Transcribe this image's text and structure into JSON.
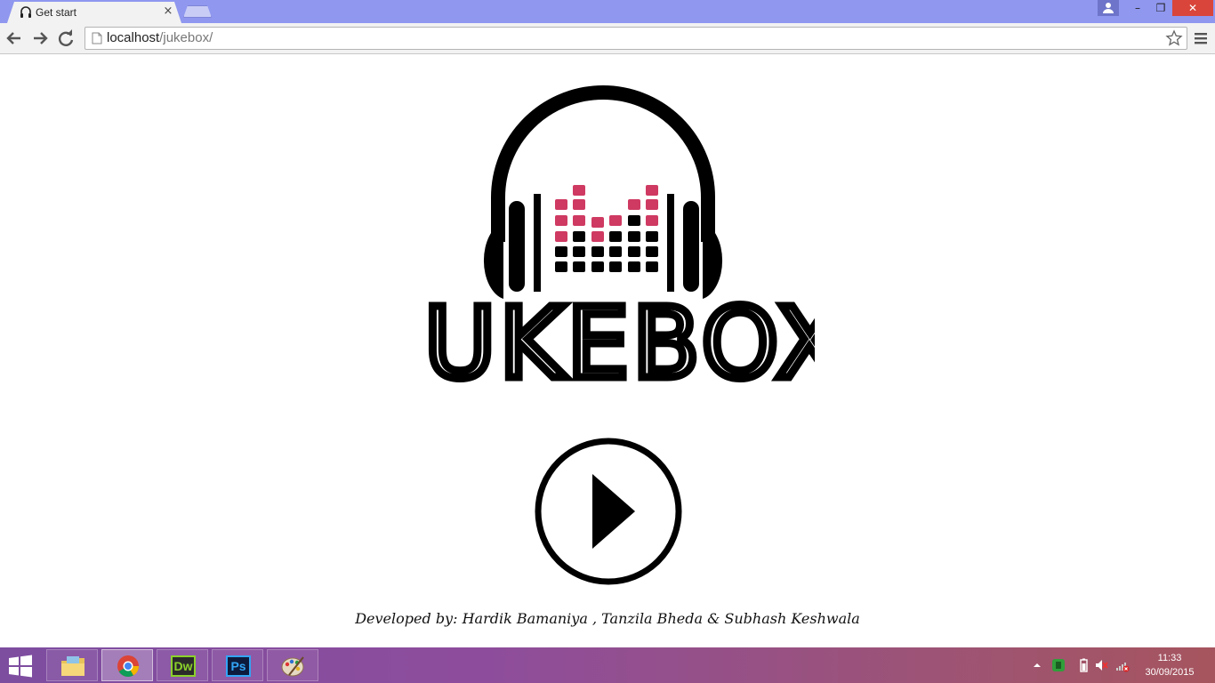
{
  "browser": {
    "tab_title": "Get start",
    "tab_close": "×",
    "url_host": "localhost",
    "url_path": "/jukebox/"
  },
  "window_controls": {
    "minimize": "–",
    "maximize": "❐",
    "close": "✕"
  },
  "page": {
    "logo_text": "JUKEBOX",
    "credits": "Developed by: Hardik Bamaniya , Tanzila Bheda & Subhash Keshwala"
  },
  "taskbar": {
    "apps": [
      {
        "name": "File Explorer",
        "icon": "folder-icon"
      },
      {
        "name": "Google Chrome",
        "icon": "chrome-icon",
        "active": true
      },
      {
        "name": "Dreamweaver",
        "icon": "dreamweaver-icon",
        "label": "Dw"
      },
      {
        "name": "Photoshop",
        "icon": "photoshop-icon",
        "label": "Ps"
      },
      {
        "name": "Paint",
        "icon": "paint-icon"
      }
    ],
    "time": "11:33",
    "date": "30/09/2015"
  },
  "colors": {
    "titlebar": "#8f97ef",
    "close_button": "#d9453a",
    "eq_pink": "#cf3a62",
    "taskbar_start": "#7d4da0",
    "taskbar_end": "#a6555e"
  }
}
